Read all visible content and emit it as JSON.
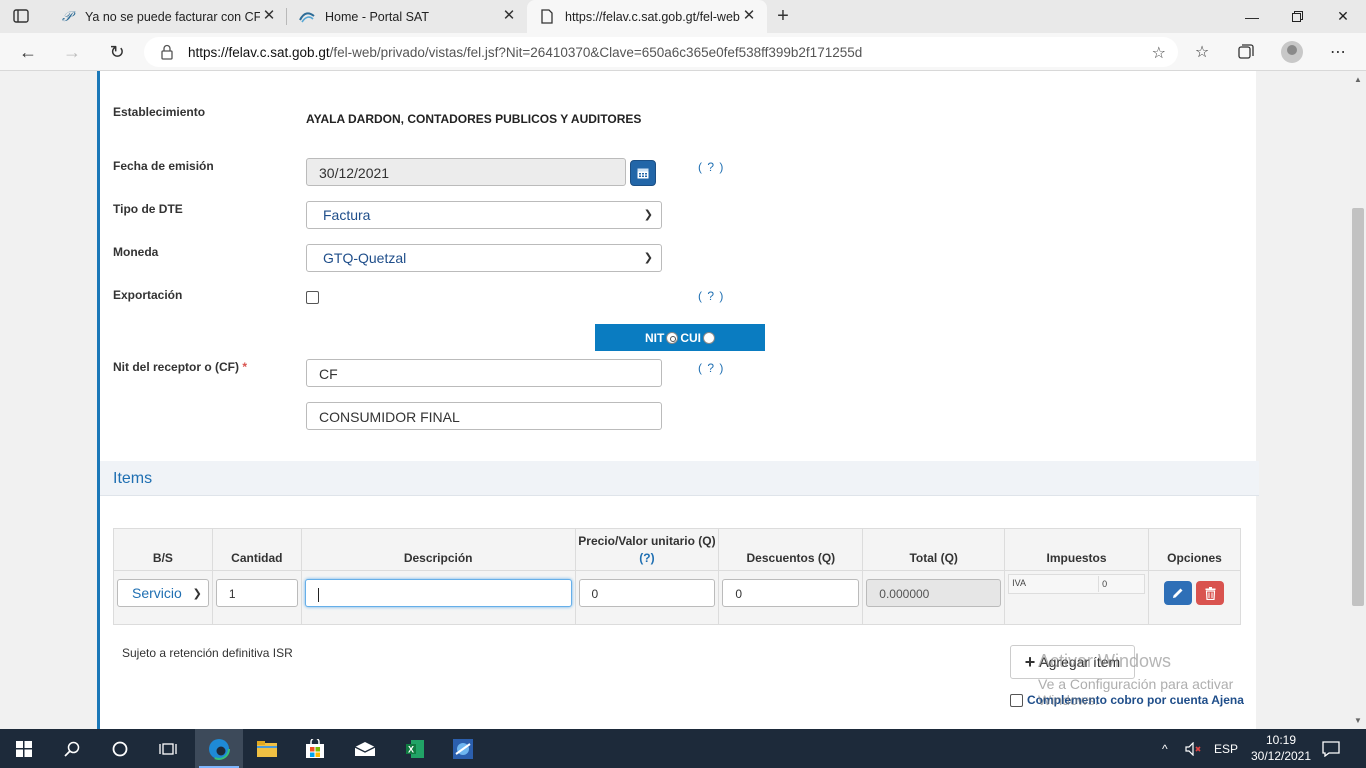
{
  "browser": {
    "tabs": [
      {
        "title": "Ya no se puede facturar con CF -",
        "icon": "script-p-icon",
        "active": false
      },
      {
        "title": "Home - Portal SAT",
        "icon": "sat-swoosh-icon",
        "active": false
      },
      {
        "title": "https://felav.c.sat.gob.gt/fel-web",
        "icon": "page-icon",
        "active": true
      }
    ],
    "url_domain": "https://felav.c.sat.gob.gt",
    "url_path": "/fel-web/privado/vistas/fel.jsf?Nit=26410370&Clave=650a6c365e0fef538ff399b2f171255d"
  },
  "form": {
    "establecimiento_label": "Establecimiento",
    "establecimiento_value": "AYALA DARDON, CONTADORES PUBLICOS Y AUDITORES",
    "fecha_label": "Fecha de emisión",
    "fecha_value": "30/12/2021",
    "help_text": "( ? )",
    "tipo_dte_label": "Tipo de DTE",
    "tipo_dte_value": "Factura",
    "moneda_label": "Moneda",
    "moneda_value": "GTQ-Quetzal",
    "exportacion_label": "Exportación",
    "nit_option": "NIT",
    "cui_option": "CUI",
    "nit_receptor_label": "Nit del receptor o (CF)",
    "required_mark": "*",
    "nit_value": "CF",
    "nombre_value": "CONSUMIDOR FINAL"
  },
  "items": {
    "section_title": "Items",
    "headers": {
      "bs": "B/S",
      "cantidad": "Cantidad",
      "descripcion": "Descripción",
      "precio": "Precio/Valor unitario (Q)",
      "precio_help": "(?)",
      "descuentos": "Descuentos (Q)",
      "total": "Total (Q)",
      "impuestos": "Impuestos",
      "opciones": "Opciones"
    },
    "row": {
      "bs": "Servicio",
      "cantidad": "1",
      "descripcion": "",
      "precio": "0",
      "descuentos": "0",
      "total": "0.000000",
      "tax_name": "IVA",
      "tax_value": "0"
    },
    "isr_text": "Sujeto a retención definitiva ISR",
    "add_button": "Agregar ítem",
    "complemento_label": "Complemento cobro por cuenta Ajena"
  },
  "watermark": {
    "line1": "Activar Windows",
    "line2": "Ve a Configuración para activar Windows."
  },
  "taskbar": {
    "language": "ESP",
    "time": "10:19",
    "date": "30/12/2021"
  }
}
